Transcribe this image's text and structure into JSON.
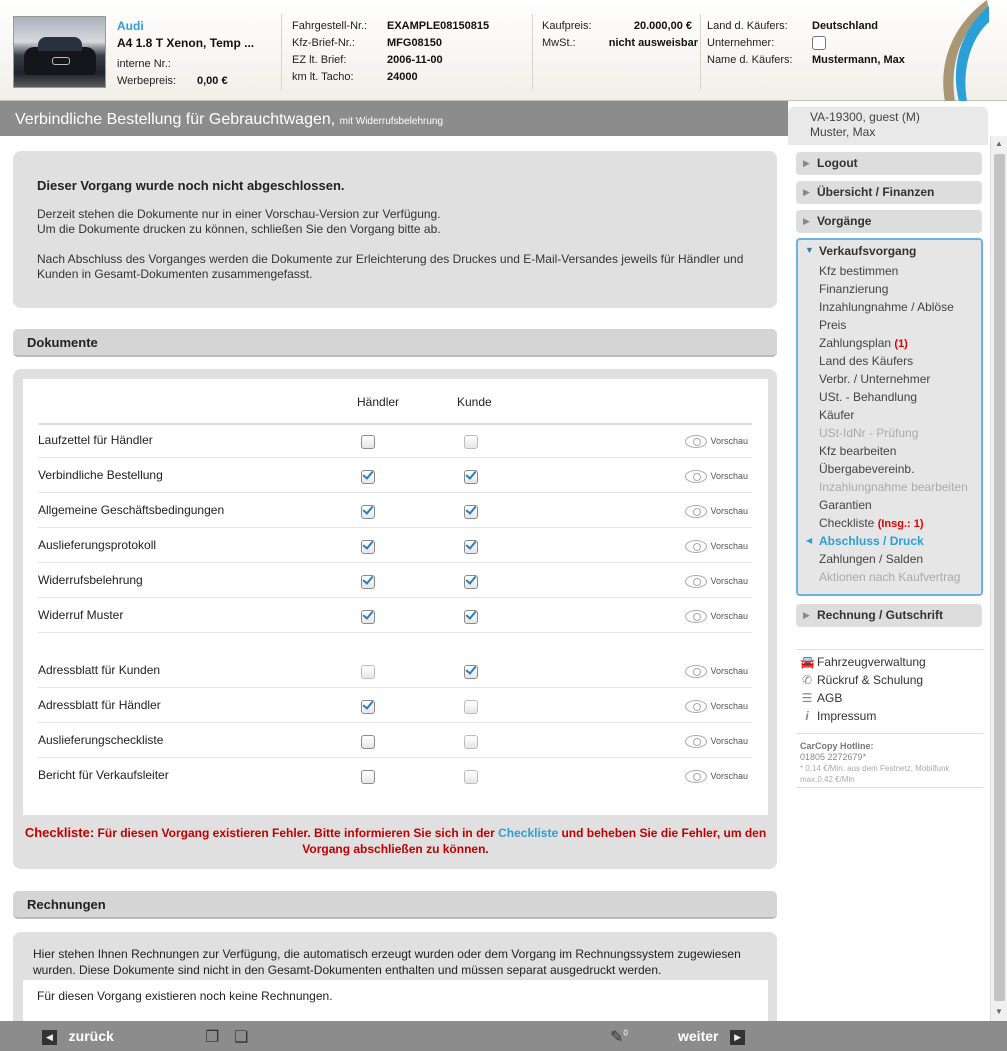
{
  "header": {
    "brand": "Audi",
    "model": "A4 1.8 T Xenon, Temp ...",
    "internal_no_label": "interne Nr.:",
    "internal_no_value": "",
    "ad_price_label": "Werbepreis:",
    "ad_price_value": "0,00 €",
    "vin_label": "Fahrgestell-Nr.:",
    "vin_value": "EXAMPLE08150815",
    "doc_label": "Kfz-Brief-Nr.:",
    "doc_value": "MFG08150",
    "ez_label": "EZ lt. Brief:",
    "ez_value": "2006-11-00",
    "km_label": "km lt. Tacho:",
    "km_value": "24000",
    "price_label": "Kaufpreis:",
    "price_value": "20.000,00 €",
    "vat_label": "MwSt.:",
    "vat_value": "nicht ausweisbar",
    "country_label": "Land d. Käufers:",
    "country_value": "Deutschland",
    "company_label": "Unternehmer:",
    "buyer_label": "Name d. Käufers:",
    "buyer_value": "Mustermann, Max"
  },
  "title": {
    "main": "Verbindliche Bestellung für Gebrauchtwagen,",
    "sub": "mit Widerrufsbelehrung"
  },
  "notice": {
    "heading": "Dieser Vorgang wurde noch nicht abgeschlossen.",
    "line1": "Derzeit stehen die Dokumente nur in einer Vorschau-Version zur Verfügung.",
    "line2": "Um die Dokumente drucken zu können, schließen Sie den Vorgang bitte ab.",
    "line3": "Nach Abschluss des Vorganges werden die Dokumente zur Erleichterung des Druckes und E-Mail-Versandes jeweils für Händler und Kunden in Gesamt-Dokumenten zusammengefasst."
  },
  "documents": {
    "heading": "Dokumente",
    "col_dealer": "Händler",
    "col_customer": "Kunde",
    "preview_label": "Vorschau",
    "rows": [
      {
        "name": "Laufzettel für Händler",
        "dealer": false,
        "customer": false,
        "dealer_dim": false,
        "customer_dim": false
      },
      {
        "name": "Verbindliche Bestellung",
        "dealer": true,
        "customer": true
      },
      {
        "name": "Allgemeine Geschäftsbedingungen",
        "dealer": true,
        "customer": true
      },
      {
        "name": "Auslieferungsprotokoll",
        "dealer": true,
        "customer": true
      },
      {
        "name": "Widerrufsbelehrung",
        "dealer": true,
        "customer": true
      },
      {
        "name": "Widerruf Muster",
        "dealer": true,
        "customer": true
      },
      {
        "name": "Adressblatt für Kunden",
        "dealer": false,
        "customer": true
      },
      {
        "name": "Adressblatt für Händler",
        "dealer": true,
        "customer": false
      },
      {
        "name": "Auslieferungscheckliste",
        "dealer": false,
        "customer": false
      },
      {
        "name": "Bericht für Verkaufsleiter",
        "dealer": false,
        "customer": false
      }
    ],
    "check_prefix": "Checkliste:",
    "check_text1": "Für diesen Vorgang existieren Fehler. Bitte informieren Sie sich in der",
    "check_link": "Checkliste",
    "check_text2": "und beheben Sie die Fehler, um den",
    "check_text3": "Vorgang abschließen zu können."
  },
  "invoices": {
    "heading": "Rechnungen",
    "info": "Hier stehen Ihnen Rechnungen zur Verfügung, die automatisch erzeugt wurden oder dem Vorgang im Rechnungssystem zugewiesen wurden. Diese Dokumente sind nicht in den Gesamt-Dokumenten enthalten und müssen separat ausgedruckt werden.",
    "none": "Für diesen Vorgang existieren noch keine Rechnungen."
  },
  "sidebar": {
    "user_line1": "VA-19300, guest (M)",
    "user_line2": "Muster, Max",
    "logout": "Logout",
    "overview": "Übersicht / Finanzen",
    "processes": "Vorgänge",
    "sales_process": "Verkaufsvorgang",
    "sales_items": [
      {
        "label": "Kfz bestimmen",
        "state": "normal"
      },
      {
        "label": "Finanzierung",
        "state": "normal"
      },
      {
        "label": "Inzahlungnahme / Ablöse",
        "state": "normal"
      },
      {
        "label": "Preis",
        "state": "normal"
      },
      {
        "label": "Zahlungsplan",
        "state": "normal",
        "badge": "(1)"
      },
      {
        "label": "Land des Käufers",
        "state": "normal"
      },
      {
        "label": "Verbr. / Unternehmer",
        "state": "normal"
      },
      {
        "label": "USt. - Behandlung",
        "state": "normal"
      },
      {
        "label": "Käufer",
        "state": "normal"
      },
      {
        "label": "USt-IdNr - Prüfung",
        "state": "off"
      },
      {
        "label": "Kfz bearbeiten",
        "state": "normal"
      },
      {
        "label": "Übergabevereinb.",
        "state": "normal"
      },
      {
        "label": "Inzahlungnahme bearbeiten",
        "state": "off"
      },
      {
        "label": "Garantien",
        "state": "normal"
      },
      {
        "label": "Checkliste",
        "state": "normal",
        "badge": "(Insg.: 1)"
      },
      {
        "label": "Abschluss / Druck",
        "state": "current"
      },
      {
        "label": "Zahlungen / Salden",
        "state": "normal"
      },
      {
        "label": "Aktionen nach Kaufvertrag",
        "state": "off"
      }
    ],
    "invoice": "Rechnung / Gutschrift",
    "links": [
      "Fahrzeugverwaltung",
      "Rückruf & Schulung",
      "AGB",
      "Impressum"
    ],
    "hotline_label": "CarCopy Hotline:",
    "hotline_number": "01805 2272679*",
    "hotline_note1": "* 0,14 €/Min. aus dem Festnetz, Mobilfunk",
    "hotline_note2": "max.0,42 €/Min"
  },
  "footer": {
    "back": "zurück",
    "next": "weiter",
    "note_count": "0"
  },
  "colors": {
    "accent": "#2a9fd8",
    "error": "#c00000",
    "bar": "#8c8c8c"
  }
}
